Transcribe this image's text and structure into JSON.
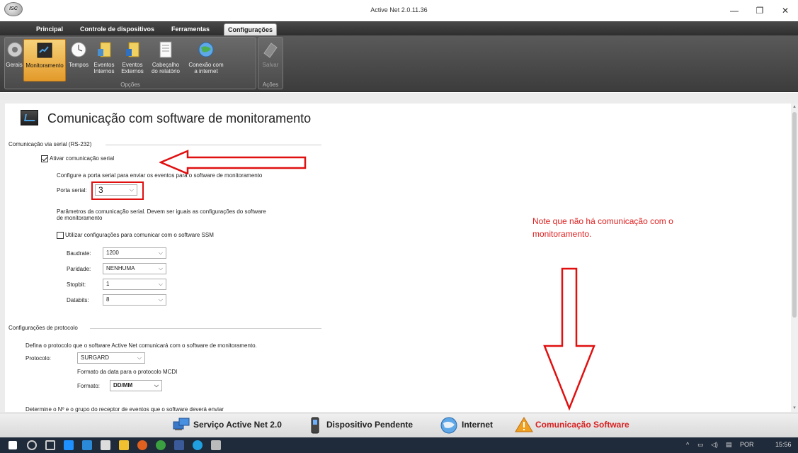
{
  "window": {
    "title": "Active Net 2.0.11.36",
    "logo_text": "ISC",
    "minimize": "—",
    "maximize": "❐",
    "close": "✕"
  },
  "menu": {
    "tabs": [
      {
        "label": "Principal"
      },
      {
        "label": "Controle de dispositivos"
      },
      {
        "label": "Ferramentas"
      },
      {
        "label": "Configurações"
      }
    ]
  },
  "ribbon": {
    "options_group_label": "Opções",
    "actions_group_label": "Ações",
    "buttons": [
      {
        "label": "Gerais",
        "icon": "gear-icon"
      },
      {
        "label": "Monitoramento",
        "icon": "monitor-icon"
      },
      {
        "label": "Tempos",
        "icon": "clock-icon"
      },
      {
        "label": "Eventos\nInternos",
        "icon": "internal-events-icon"
      },
      {
        "label": "Eventos\nExternos",
        "icon": "external-events-icon"
      },
      {
        "label": "Cabeçalho\ndo relatório",
        "icon": "report-header-icon"
      },
      {
        "label": "Conexão com\na internet",
        "icon": "globe-icon"
      },
      {
        "label": "Salvar",
        "icon": "save-icon"
      }
    ]
  },
  "page": {
    "title": "Comunicação com software de monitoramento",
    "serial_section": "Comunicação via serial (RS-232)",
    "enable_serial_label": "Ativar comunicação serial",
    "enable_serial_checked": true,
    "configure_port_text": "Configure a porta serial para enviar os eventos para o software de monitoramento",
    "serial_port_label": "Porta serial:",
    "serial_port_value": "3",
    "params_text_1": "Parâmetros da comunicação serial. Devem ser iguais as configurações do software",
    "params_text_2": "de monitoramento",
    "ssm_label": "Utilizar configurações para comunicar com o software SSM",
    "ssm_checked": false,
    "baudrate_label": "Baudrate:",
    "baudrate_value": "1200",
    "parity_label": "Paridade:",
    "parity_value": "NENHUMA",
    "stopbit_label": "Stopbit:",
    "stopbit_value": "1",
    "databits_label": "Databits:",
    "databits_value": "8",
    "protocol_section": "Configurações de protocolo",
    "protocol_text": "Defina o protocolo que o software Active Net comunicará com o software de monitoramento.",
    "protocol_label": "Protocolo:",
    "protocol_value": "SURGARD",
    "date_format_text": "Formato da data para o protocolo MCDI",
    "format_label": "Formato:",
    "format_value": "DD/MM",
    "receiver_text": "Determine o Nº e o grupo do receptor de eventos que o software deverá enviar"
  },
  "annotation": {
    "note": "Note que não há comunicação com o monitoramento.",
    "color": "#e02020"
  },
  "statusbar": {
    "items": [
      {
        "label": "Serviço Active Net 2.0",
        "icon": "service-computers-icon"
      },
      {
        "label": "Dispositivo Pendente",
        "icon": "pending-device-icon"
      },
      {
        "label": "Internet",
        "icon": "globe-icon"
      },
      {
        "label": "Comunicação Software",
        "icon": "warning-icon"
      }
    ]
  },
  "taskbar": {
    "language": "POR",
    "time": "15:56"
  }
}
